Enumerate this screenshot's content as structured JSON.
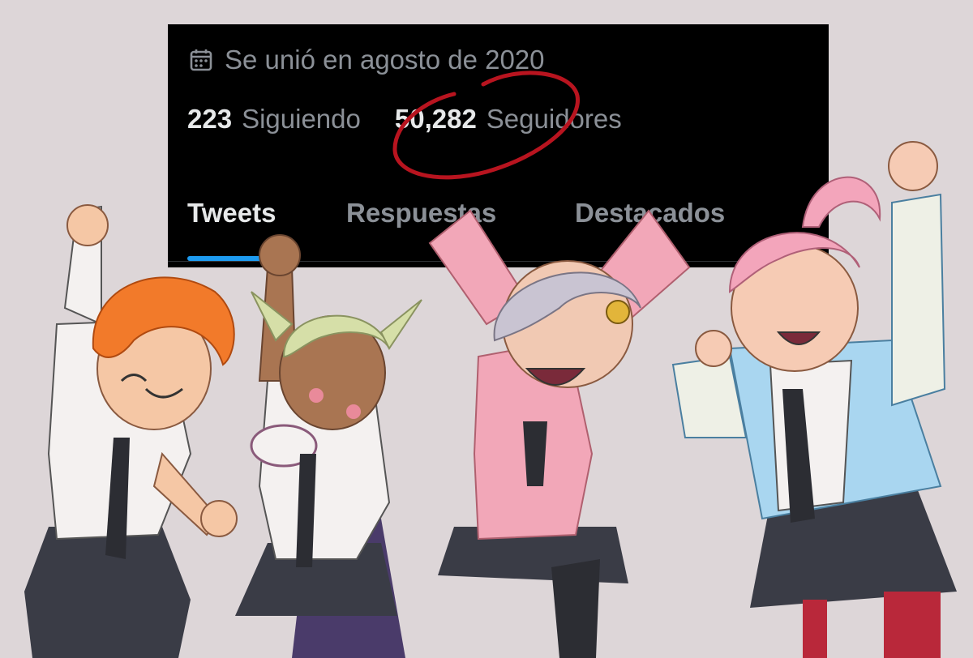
{
  "profile": {
    "joined_text": "Se unió en agosto de 2020",
    "following_count": "223",
    "following_label": "Siguiendo",
    "followers_count": "50,282",
    "followers_label": "Seguidores"
  },
  "tabs": [
    {
      "label": "Tweets",
      "active": true
    },
    {
      "label": "Respuestas",
      "active": false
    },
    {
      "label": "Destacados",
      "active": false
    }
  ],
  "colors": {
    "background": "#ddd6d8",
    "card": "#000000",
    "accent": "#1d9bf0",
    "circle": "#b8141f"
  },
  "illustration": {
    "characters": [
      {
        "hair": "#f27a2a",
        "skin": "#f5c7a5",
        "top": "#f4f1f0"
      },
      {
        "hair": "#d6dfa8",
        "skin": "#a97552",
        "top": "#f4f1f0"
      },
      {
        "hair": "#c9c4d2",
        "skin": "#f1c9b3",
        "top": "#f2a7b8"
      },
      {
        "hair": "#f3a5bb",
        "skin": "#f6cbb4",
        "top": "#a9d6f0"
      }
    ]
  }
}
